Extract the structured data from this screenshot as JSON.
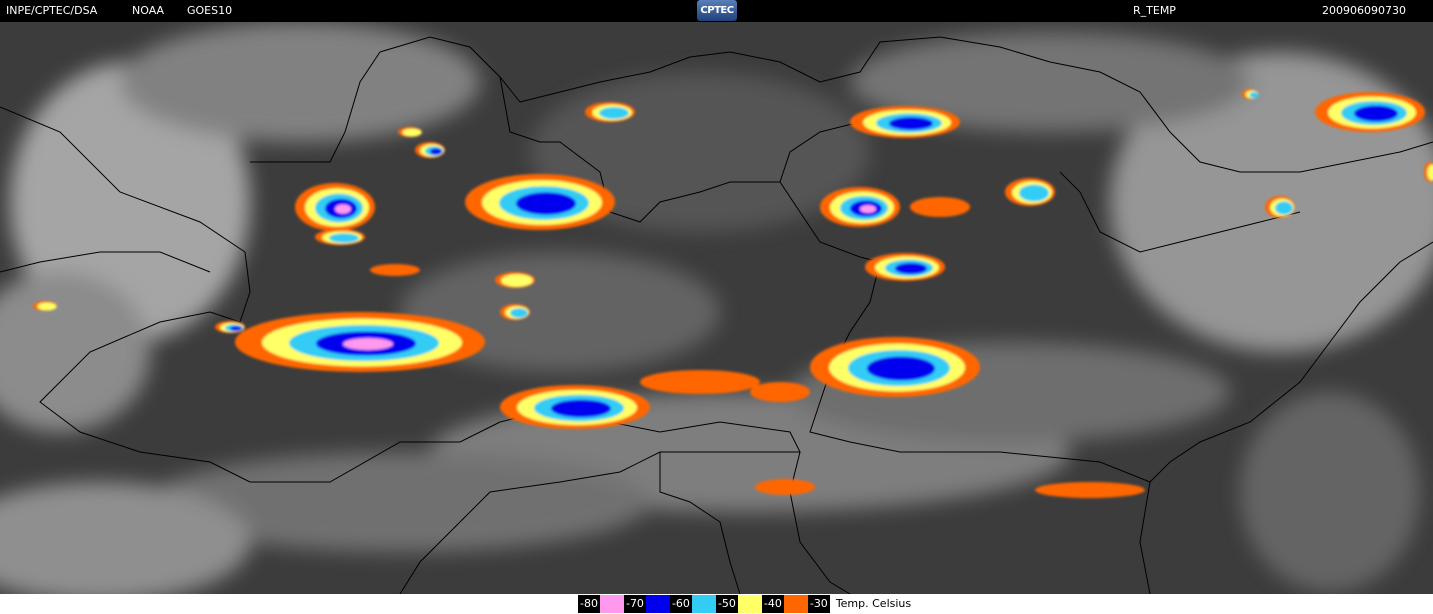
{
  "header": {
    "source": "INPE/CPTEC/DSA",
    "agency": "NOAA",
    "satellite": "GOES10",
    "logo_text": "CPTEC",
    "product": "R_TEMP",
    "timestamp": "200906090730"
  },
  "colors": {
    "background": "#000000",
    "ground_dark": "#3a3a3a",
    "cloud_light": "#c8c8c8",
    "border_line": "#000000"
  },
  "legend": {
    "entries": [
      {
        "label": "-80",
        "color": "#ff99ee"
      },
      {
        "label": "-70",
        "color": "#0000ee"
      },
      {
        "label": "-60",
        "color": "#33ccf5"
      },
      {
        "label": "-50",
        "color": "#ffff66"
      },
      {
        "label": "-40",
        "color": "#ff6600"
      },
      {
        "label": "-30",
        "color": ""
      }
    ],
    "units": "Temp. Celsius"
  }
}
